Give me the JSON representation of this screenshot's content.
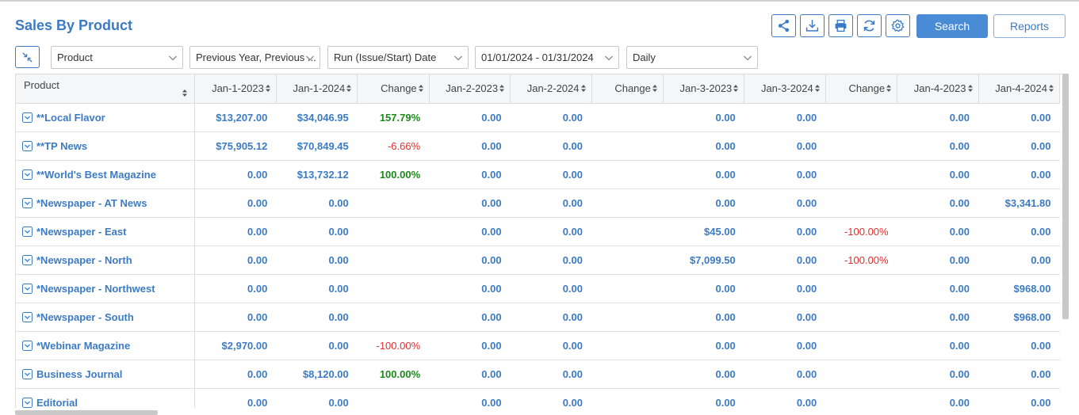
{
  "header": {
    "title": "Sales By Product",
    "search_label": "Search",
    "reports_label": "Reports",
    "toolbar_icons": [
      "share-icon",
      "download-icon",
      "print-icon",
      "refresh-icon",
      "settings-icon"
    ]
  },
  "filters": {
    "group_by": "Product",
    "comparison": "Previous Year, Previous ...",
    "date_type": "Run (Issue/Start) Date",
    "date_range": "01/01/2024 - 01/31/2024",
    "interval": "Daily"
  },
  "colors": {
    "accent": "#3c7bc4",
    "positive": "#1a8a1a",
    "negative": "#e03030"
  },
  "table": {
    "columns": [
      "Product",
      "Jan-1-2023",
      "Jan-1-2024",
      "Change",
      "Jan-2-2023",
      "Jan-2-2024",
      "Change",
      "Jan-3-2023",
      "Jan-3-2024",
      "Change",
      "Jan-4-2023",
      "Jan-4-2024"
    ],
    "rows": [
      {
        "name": "**Local Flavor",
        "cells": [
          "$13,207.00",
          "$34,046.95",
          "157.79%",
          "0.00",
          "0.00",
          "",
          "0.00",
          "0.00",
          "",
          "0.00",
          "0.00"
        ]
      },
      {
        "name": "**TP News",
        "cells": [
          "$75,905.12",
          "$70,849.45",
          "-6.66%",
          "0.00",
          "0.00",
          "",
          "0.00",
          "0.00",
          "",
          "0.00",
          "0.00"
        ]
      },
      {
        "name": "**World's Best Magazine",
        "cells": [
          "0.00",
          "$13,732.12",
          "100.00%",
          "0.00",
          "0.00",
          "",
          "0.00",
          "0.00",
          "",
          "0.00",
          "0.00"
        ]
      },
      {
        "name": "*Newspaper - AT News",
        "cells": [
          "0.00",
          "0.00",
          "",
          "0.00",
          "0.00",
          "",
          "0.00",
          "0.00",
          "",
          "0.00",
          "$3,341.80"
        ]
      },
      {
        "name": "*Newspaper - East",
        "cells": [
          "0.00",
          "0.00",
          "",
          "0.00",
          "0.00",
          "",
          "$45.00",
          "0.00",
          "-100.00%",
          "0.00",
          "0.00"
        ]
      },
      {
        "name": "*Newspaper - North",
        "cells": [
          "0.00",
          "0.00",
          "",
          "0.00",
          "0.00",
          "",
          "$7,099.50",
          "0.00",
          "-100.00%",
          "0.00",
          "0.00"
        ]
      },
      {
        "name": "*Newspaper - Northwest",
        "cells": [
          "0.00",
          "0.00",
          "",
          "0.00",
          "0.00",
          "",
          "0.00",
          "0.00",
          "",
          "0.00",
          "$968.00"
        ]
      },
      {
        "name": "*Newspaper - South",
        "cells": [
          "0.00",
          "0.00",
          "",
          "0.00",
          "0.00",
          "",
          "0.00",
          "0.00",
          "",
          "0.00",
          "$968.00"
        ]
      },
      {
        "name": "*Webinar Magazine",
        "cells": [
          "$2,970.00",
          "0.00",
          "-100.00%",
          "0.00",
          "0.00",
          "",
          "0.00",
          "0.00",
          "",
          "0.00",
          "0.00"
        ]
      },
      {
        "name": "Business Journal",
        "cells": [
          "0.00",
          "$8,120.00",
          "100.00%",
          "0.00",
          "0.00",
          "",
          "0.00",
          "0.00",
          "",
          "0.00",
          "0.00"
        ]
      },
      {
        "name": "Editorial",
        "cells": [
          "0.00",
          "0.00",
          "",
          "0.00",
          "0.00",
          "",
          "0.00",
          "0.00",
          "",
          "0.00",
          "0.00"
        ]
      }
    ]
  }
}
